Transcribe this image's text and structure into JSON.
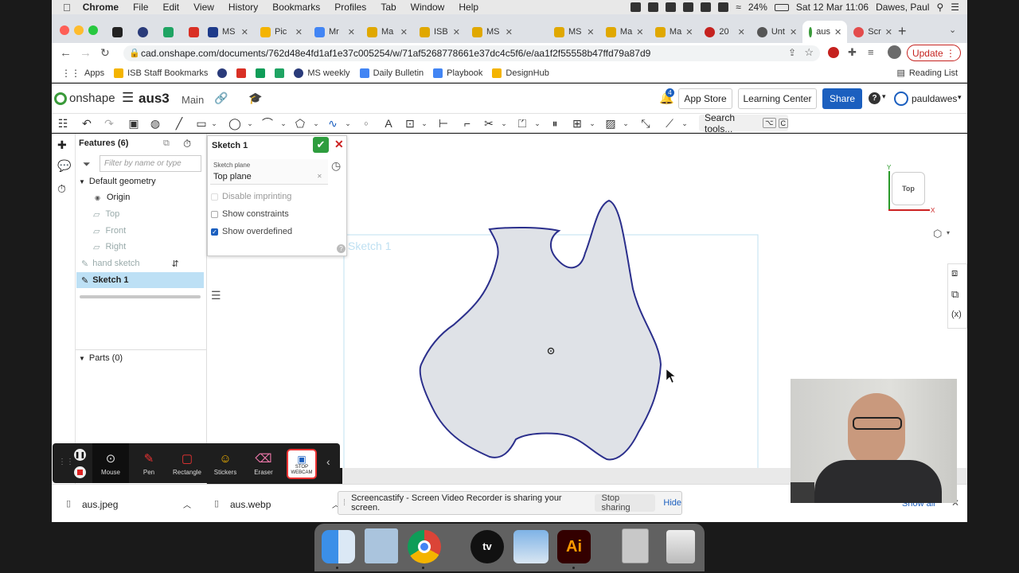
{
  "mac_menu": {
    "app_name": "Chrome",
    "items": [
      "File",
      "Edit",
      "View",
      "History",
      "Bookmarks",
      "Profiles",
      "Tab",
      "Window",
      "Help"
    ],
    "battery": "24%",
    "clock": "Sat 12 Mar  11:06",
    "user": "Dawes, Paul"
  },
  "tabs": [
    "MS",
    "Pic",
    "Mr",
    "Ma",
    "ISB",
    "MS",
    "MS",
    "Ma",
    "Ma",
    "20",
    "Unt",
    "aus",
    "Scr"
  ],
  "address": {
    "url": "cad.onshape.com/documents/762d48e4fd1af1e37c005254/w/71af5268778661e37dc4c5f6/e/aa1f2f55558b47ffd79a87d9",
    "update_label": "Update"
  },
  "bookmarks": {
    "items": [
      "Apps",
      "ISB Staff Bookmarks",
      "MS weekly",
      "Daily Bulletin",
      "Playbook",
      "DesignHub"
    ],
    "reading_list": "Reading List"
  },
  "onshape": {
    "logo_text": "onshape",
    "doc_name": "aus3",
    "branch": "Main",
    "notif_count": "4",
    "app_store": "App Store",
    "learning_center": "Learning Center",
    "share": "Share",
    "help": "?",
    "username": "pauldawes"
  },
  "toolbar": {
    "search_label": "Search tools...",
    "shortcut1": "⌥",
    "shortcut2": "C"
  },
  "features": {
    "title": "Features (6)",
    "filter_placeholder": "Filter by name or type",
    "default_geometry": "Default geometry",
    "items": [
      "Origin",
      "Top",
      "Front",
      "Right"
    ],
    "hand_sketch": "hand sketch",
    "sketch1": "Sketch 1",
    "parts": "Parts (0)"
  },
  "sketch_dialog": {
    "title": "Sketch 1",
    "plane_label": "Sketch plane",
    "plane_value": "Top plane",
    "opt1": "Disable imprinting",
    "opt2": "Show constraints",
    "opt3": "Show overdefined",
    "opt3_checked": true,
    "help": "?"
  },
  "canvas": {
    "sketch_label": "Sketch 1",
    "view_cube_label": "Top",
    "axis_y": "Y",
    "axis_x": "X"
  },
  "annotation_toolbar": [
    "Mouse",
    "Pen",
    "Rectangle",
    "Stickers",
    "Eraser",
    "STOP WEBCAM"
  ],
  "downloads": [
    "aus.jpeg",
    "aus.webp"
  ],
  "share_bar": {
    "message": "Screencastify - Screen Video Recorder is sharing your screen.",
    "stop": "Stop sharing",
    "hide": "Hide"
  },
  "show_all": "Show all",
  "colors": {
    "onshape_green": "#3a9a3a",
    "share_blue": "#1b5fbf",
    "selection_blue": "#bde0f5",
    "sketch_line": "#2b2f8c",
    "sketch_fill": "#dfe2e7",
    "update_red": "#c5221f"
  }
}
